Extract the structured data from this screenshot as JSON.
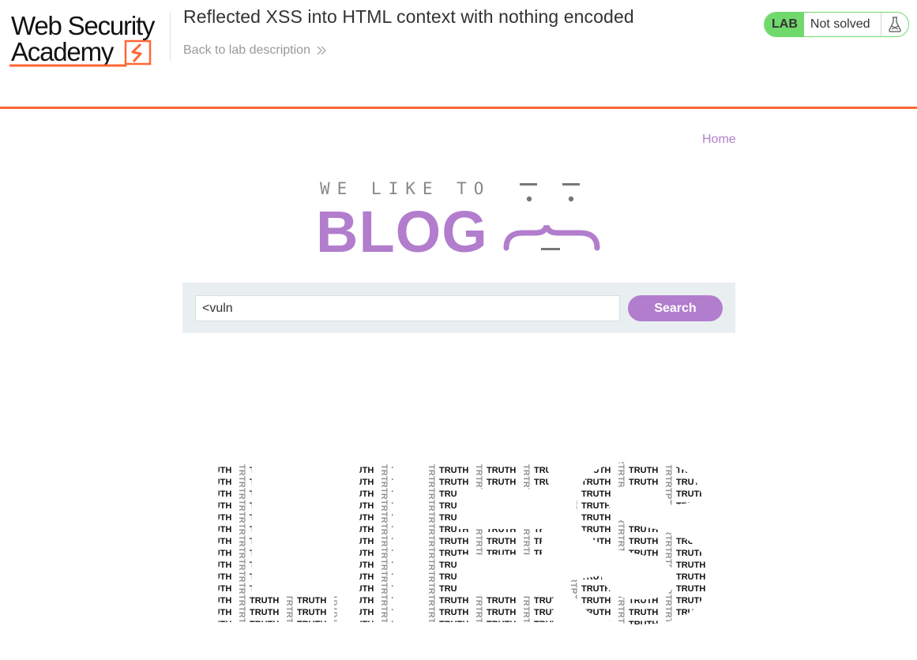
{
  "academy": {
    "logo_line1": "Web Security",
    "logo_line2": "Academy",
    "lab_title": "Reflected XSS into HTML context with nothing encoded",
    "back_link": "Back to lab description",
    "status_badge": "LAB",
    "status_text": "Not solved",
    "icons": {
      "back": "double-chevron-right-icon",
      "status": "flask-icon"
    }
  },
  "blog": {
    "nav": {
      "home": "Home"
    },
    "logo": {
      "tagline": "WE LIKE TO",
      "name": "BLOG"
    },
    "search": {
      "value": "<vuln",
      "button": "Search"
    },
    "post_image": {
      "big_word": "LIES",
      "fill_word": "TRUTH"
    }
  },
  "colors": {
    "academy_accent": "#ff6633",
    "blog_accent": "#b27dcd",
    "lab_green": "#70d96c",
    "search_panel": "#e9eef1"
  }
}
